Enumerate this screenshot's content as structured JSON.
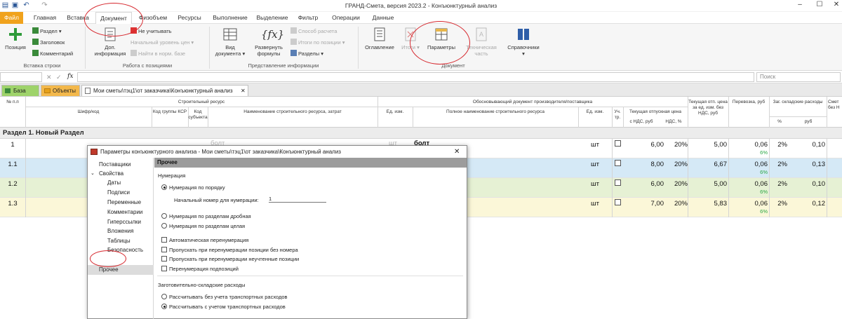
{
  "title": "ГРАНД-Смета, версия 2023.2 - Конъюнктурный анализ",
  "menu": {
    "file": "Файл",
    "tabs": [
      "Главная",
      "Вставка",
      "Документ",
      "Физобъем",
      "Ресурсы",
      "Выполнение",
      "Выделение",
      "Фильтр",
      "Операции",
      "Данные"
    ]
  },
  "ribbon": {
    "position": "Позиция",
    "section": "Раздел",
    "heading": "Заголовок",
    "comment": "Комментарий",
    "insert_row_group": "Вставка строки",
    "dop_info_1": "Доп.",
    "dop_info_2": "информация",
    "not_account": "Не учитывать",
    "start_level": "Начальный уровень цен",
    "find_norm": "Найти в норм. базе",
    "positions_group": "Работа с позициями",
    "view_doc_1": "Вид",
    "view_doc_2": "документа",
    "show_formulas_1": "Развернуть",
    "show_formulas_2": "формулы",
    "calc_method": "Способ расчета",
    "totals_by_pos": "Итоги по позиции",
    "sections": "Разделы",
    "info_view_group": "Представление информации",
    "contents": "Оглавление",
    "totals": "Итоги",
    "params": "Параметры",
    "tech_part_1": "Техническая",
    "tech_part_2": "часть",
    "reference": "Справочники",
    "document_group": "Документ"
  },
  "formula": {
    "search_placeholder": "Поиск",
    "fx": "fx"
  },
  "doctabs": {
    "base": "База",
    "objects": "Объекты",
    "path": "Мои сметы\\тэц1\\от заказчика\\Конъюнктурный анализ"
  },
  "grid": {
    "h_num": "№ п.п",
    "h_cipher": "Шифр/код",
    "h_res": "Строительный ресурс",
    "h_ksr": "Код группы КСР",
    "h_subj": "Код субъекта",
    "h_resname": "Наименование строительного ресурса, затрат",
    "h_unit": "Ед. изм.",
    "h_justdoc": "Обосновывающий документ производителя/поставщика",
    "h_fullname": "Полное наименование строительного ресурса",
    "h_unit2": "Ед. изм.",
    "h_uch": "Уч. тр.",
    "h_curprice": "Текущая отпускная цена",
    "h_withvat": "с НДС, руб",
    "h_vat": "НДС, %",
    "h_curcost": "Текущая отп. цена за ед. изм. без НДС, руб",
    "h_transport": "Перевозка, руб",
    "h_storage": "Заг. складские расходы",
    "h_pct": "%",
    "h_rub": "руб",
    "h_last": "Смет без Н",
    "section_title": "Раздел 1. Новый Раздел",
    "rows": [
      {
        "num": "1",
        "unit": "шт",
        "price": "6,00",
        "vat": "20%",
        "cost": "5,00",
        "transport": "0,06",
        "tpct": "6%",
        "spct": "2%",
        "srub": "0,10"
      },
      {
        "num": "1.1",
        "unit": "шт",
        "price": "8,00",
        "vat": "20%",
        "cost": "6,67",
        "transport": "0,06",
        "tpct": "6%",
        "spct": "2%",
        "srub": "0,13"
      },
      {
        "num": "1.2",
        "unit": "шт",
        "price": "6,00",
        "vat": "20%",
        "cost": "5,00",
        "transport": "0,06",
        "tpct": "6%",
        "spct": "2%",
        "srub": "0,10"
      },
      {
        "num": "1.3",
        "unit": "шт",
        "price": "7,00",
        "vat": "20%",
        "cost": "5,83",
        "transport": "0,06",
        "tpct": "6%",
        "spct": "2%",
        "srub": "0,12"
      }
    ],
    "row1_ghost_name": "болт",
    "row1_ghost_unit": "шт",
    "row1_ghost_full": "болт"
  },
  "dialog": {
    "title": "Параметры конъюнктурного анализа - Мои сметы\\тэц1\\от заказчика\\Конъюнктурный анализ",
    "nav": {
      "suppliers": "Поставщики",
      "properties": "Свойства",
      "dates": "Даты",
      "signatures": "Подписи",
      "variables": "Переменные",
      "comments": "Комментарии",
      "hyperlinks": "Гиперссылки",
      "attachments": "Вложения",
      "tables": "Таблицы",
      "security": "Безопасность",
      "other": "Прочее"
    },
    "header": "Прочее",
    "numbering": "Нумерация",
    "by_order": "Нумерация по порядку",
    "start_num_label": "Начальный номер для нумерации:",
    "start_num_value": "1",
    "by_sections_frac": "Нумерация по разделам дробная",
    "by_sections_whole": "Нумерация по разделам целая",
    "auto_renum": "Автоматическая перенумерация",
    "skip_no_number": "Пропускать при перенумерации позиции без номера",
    "skip_unaccounted": "Пропускать при перенумерации неучтенные позиции",
    "renum_sub": "Перенумерация подпозиций",
    "storage_title": "Заготовительно-складские расходы",
    "without_transport": "Рассчитывать без учета транспортных расходов",
    "with_transport": "Рассчитывать с учетом транспортных расходов"
  }
}
